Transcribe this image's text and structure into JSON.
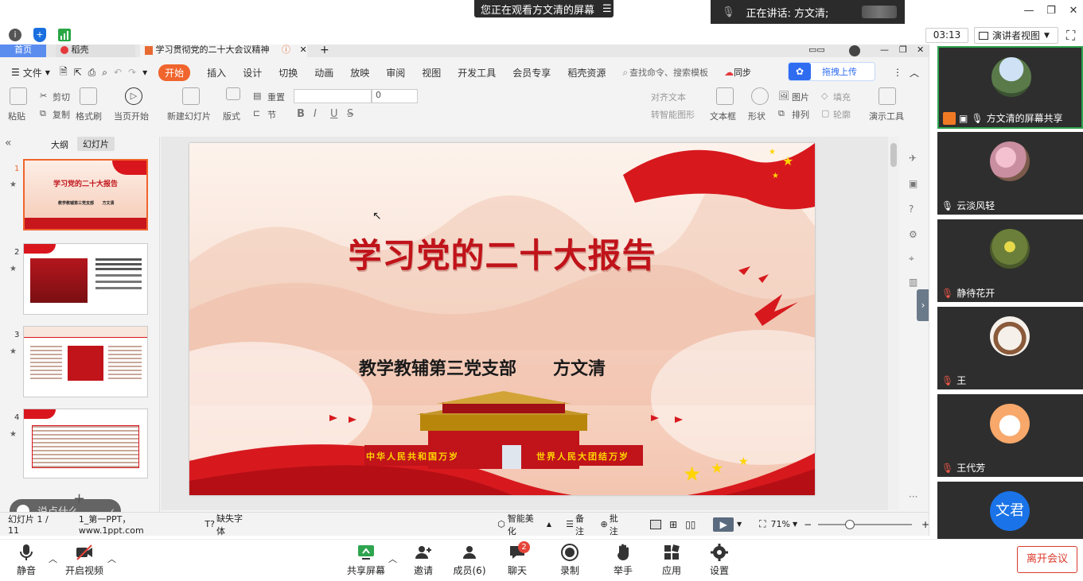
{
  "meeting": {
    "viewing_banner": "您正在观看方文清的屏幕",
    "speaking_label": "正在讲话: 方文清;",
    "timer": "03:13",
    "presenter_view": "演讲者视图"
  },
  "wps": {
    "tabs": [
      "首页",
      "稻壳",
      "学习贯彻党的二十大会议精神"
    ],
    "file_menu": "文件",
    "menus": [
      "开始",
      "插入",
      "设计",
      "切换",
      "动画",
      "放映",
      "审阅",
      "视图",
      "开发工具",
      "会员专享",
      "稻壳资源"
    ],
    "search_placeholder": "查找命令、搜索模板",
    "sync_label": "同步",
    "upload_label": "拖拽上传",
    "ribbon": {
      "paste": "粘贴",
      "cut": "剪切",
      "copy": "复制",
      "format_painter": "格式刷",
      "play_from_current": "当页开始",
      "new_slide": "新建幻灯片",
      "layout": "版式",
      "section": "节",
      "reset": "重置",
      "font_size": "0",
      "align_text": "对齐文本",
      "convert_smartart": "转智能图形",
      "textbox": "文本框",
      "shape": "形状",
      "picture": "图片",
      "arrange": "排列",
      "fill": "填充",
      "outline": "轮廓",
      "presentation_tools": "演示工具"
    },
    "panel_tabs": [
      "大纲",
      "幻灯片"
    ],
    "slide_numbers": [
      "1",
      "2",
      "3",
      "4"
    ],
    "thumb1_title": "学习党的二十大报告",
    "thumb1_sub": "教学教辅第三党支部      方文清",
    "slide": {
      "title": "学习党的二十大报告",
      "subtitle": "教学教辅第三党支部      方文清",
      "banner_left": "中华人民共和国万岁",
      "banner_right": "世界人民大团结万岁"
    },
    "comment_placeholder": "说点什么...",
    "status": {
      "slide_count": "幻灯片 1 / 11",
      "theme": "1_第一PPT，www.1ppt.com",
      "missing_font": "缺失字体",
      "beautify": "智能美化",
      "notes": "备注",
      "annotate": "批注",
      "zoom": "71%"
    }
  },
  "participants": [
    {
      "name": "方文清的屏幕共享",
      "avatar": "landscape",
      "color": "#5a7a4a"
    },
    {
      "name": "云淡风轻",
      "avatar": "flowers",
      "color": "#c98ea0"
    },
    {
      "name": "静待花开",
      "avatar": "plant",
      "color": "#6b7f3a"
    },
    {
      "name": "王",
      "avatar": "tiger-cartoon",
      "color": "#f5f0ea"
    },
    {
      "name": "王代芳",
      "avatar": "dog-cartoon",
      "color": "#f7a86a"
    },
    {
      "name": "文君",
      "avatar": "text-avatar",
      "color": "#1a73e8"
    }
  ],
  "toolbar": {
    "mute": "静音",
    "video": "开启视频",
    "share": "共享屏幕",
    "invite": "邀请",
    "members": "成员(6)",
    "chat": "聊天",
    "chat_badge": "2",
    "record": "录制",
    "raise_hand": "举手",
    "apps": "应用",
    "settings": "设置",
    "leave": "离开会议"
  }
}
